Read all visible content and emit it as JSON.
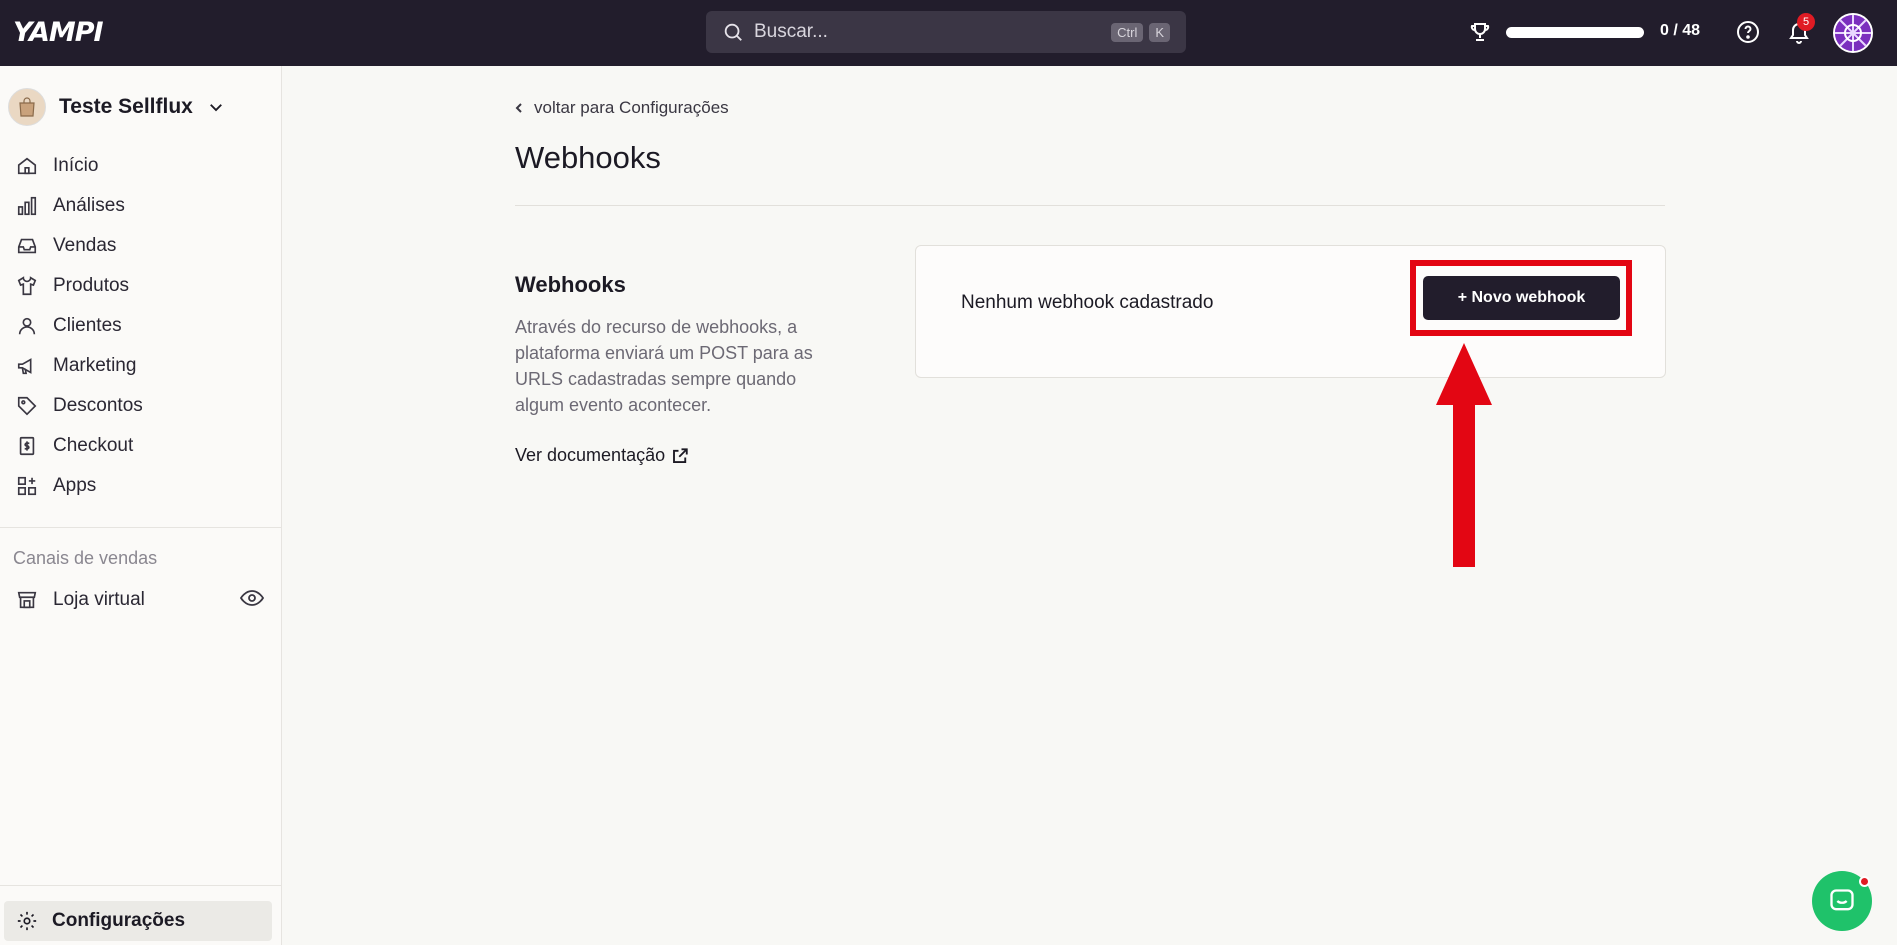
{
  "app": {
    "logo": "YAMPI"
  },
  "topbar": {
    "search_placeholder": "Buscar...",
    "shortcut_1": "Ctrl",
    "shortcut_2": "K",
    "progress_text": "0 / 48",
    "progress_fraction": 0,
    "notifications": "5"
  },
  "sidebar": {
    "store_name": "Teste Sellflux",
    "items": [
      {
        "label": "Início",
        "icon": "home-icon"
      },
      {
        "label": "Análises",
        "icon": "bar-chart-icon"
      },
      {
        "label": "Vendas",
        "icon": "inbox-icon"
      },
      {
        "label": "Produtos",
        "icon": "shirt-icon"
      },
      {
        "label": "Clientes",
        "icon": "user-icon"
      },
      {
        "label": "Marketing",
        "icon": "megaphone-icon"
      },
      {
        "label": "Descontos",
        "icon": "tag-icon"
      },
      {
        "label": "Checkout",
        "icon": "receipt-icon"
      },
      {
        "label": "Apps",
        "icon": "apps-icon"
      }
    ],
    "section_label": "Canais de vendas",
    "channel": "Loja virtual",
    "settings": "Configurações"
  },
  "main": {
    "back_link": "voltar para Configurações",
    "title": "Webhooks",
    "section_title": "Webhooks",
    "section_description": "Através do recurso de webhooks, a plataforma enviará um POST para as URLS cadastradas sempre quando algum evento acontecer.",
    "doc_link": "Ver documentação",
    "empty_state": "Nenhum webhook cadastrado",
    "new_button": "+ Novo webhook"
  },
  "colors": {
    "topbar": "#221d2c",
    "highlight": "#e30613",
    "chat": "#1fc26a"
  }
}
